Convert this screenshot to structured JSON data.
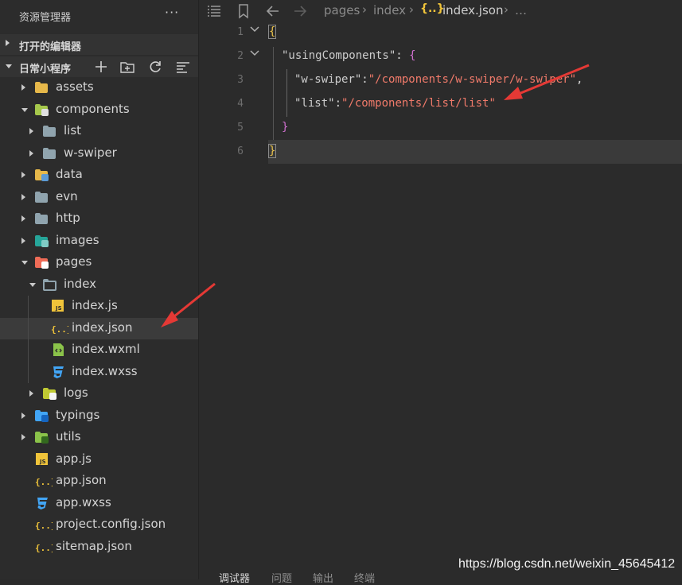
{
  "sidebar": {
    "title": "资源管理器",
    "more": "···",
    "open_editors": "打开的编辑器",
    "project_name": "日常小程序",
    "tree": [
      {
        "label": "assets",
        "depth": 1,
        "kind": "folder",
        "twisty": "right",
        "color": "#e6b84a",
        "icon": "folder-icon"
      },
      {
        "label": "components",
        "depth": 1,
        "kind": "folder",
        "twisty": "down",
        "color": "#a6c84c",
        "icon": "components-folder-icon"
      },
      {
        "label": "list",
        "depth": 2,
        "kind": "folder",
        "twisty": "right",
        "color": "#90a4ae",
        "icon": "folder-icon"
      },
      {
        "label": "w-swiper",
        "depth": 2,
        "kind": "folder",
        "twisty": "right",
        "color": "#90a4ae",
        "icon": "folder-icon"
      },
      {
        "label": "data",
        "depth": 1,
        "kind": "folder",
        "twisty": "right",
        "color": "#e6b84a",
        "icon": "data-folder-icon"
      },
      {
        "label": "evn",
        "depth": 1,
        "kind": "folder",
        "twisty": "right",
        "color": "#90a4ae",
        "icon": "folder-icon"
      },
      {
        "label": "http",
        "depth": 1,
        "kind": "folder",
        "twisty": "right",
        "color": "#90a4ae",
        "icon": "folder-icon"
      },
      {
        "label": "images",
        "depth": 1,
        "kind": "folder",
        "twisty": "right",
        "color": "#26a69a",
        "icon": "images-folder-icon"
      },
      {
        "label": "pages",
        "depth": 1,
        "kind": "folder",
        "twisty": "down",
        "color": "#ef6c57",
        "icon": "pages-folder-icon"
      },
      {
        "label": "index",
        "depth": 2,
        "kind": "folder",
        "twisty": "down",
        "color": "#90a4ae",
        "icon": "folder-open-icon"
      },
      {
        "label": "index.js",
        "depth": 3,
        "kind": "file",
        "ftype": "js"
      },
      {
        "label": "index.json",
        "depth": 3,
        "kind": "file",
        "ftype": "json",
        "selected": true
      },
      {
        "label": "index.wxml",
        "depth": 3,
        "kind": "file",
        "ftype": "wxml"
      },
      {
        "label": "index.wxss",
        "depth": 3,
        "kind": "file",
        "ftype": "wxss"
      },
      {
        "label": "logs",
        "depth": 2,
        "kind": "folder",
        "twisty": "right",
        "color": "#c0ca33",
        "icon": "logs-folder-icon"
      },
      {
        "label": "typings",
        "depth": 1,
        "kind": "folder",
        "twisty": "right",
        "color": "#42a5f5",
        "icon": "typings-folder-icon"
      },
      {
        "label": "utils",
        "depth": 1,
        "kind": "folder",
        "twisty": "right",
        "color": "#8bc34a",
        "icon": "utils-folder-icon"
      },
      {
        "label": "app.js",
        "depth": 1,
        "kind": "file",
        "ftype": "js"
      },
      {
        "label": "app.json",
        "depth": 1,
        "kind": "file",
        "ftype": "json"
      },
      {
        "label": "app.wxss",
        "depth": 1,
        "kind": "file",
        "ftype": "wxss"
      },
      {
        "label": "project.config.json",
        "depth": 1,
        "kind": "file",
        "ftype": "json"
      },
      {
        "label": "sitemap.json",
        "depth": 1,
        "kind": "file",
        "ftype": "json"
      }
    ]
  },
  "breadcrumb": {
    "items": [
      "pages",
      "index",
      "index.json"
    ],
    "json_glyph": "{..}",
    "trailing": "…"
  },
  "editor": {
    "line_numbers": [
      "1",
      "2",
      "3",
      "4",
      "5",
      "6"
    ],
    "line1": "{",
    "line2_key": "\"usingComponents\"",
    "line2_colon": ": ",
    "line2_brace": "{",
    "line3_key": "\"w-swiper\"",
    "line3_colon": ":",
    "line3_val": "\"/components/w-swiper/w-swiper\"",
    "line3_comma": ",",
    "line4_key": "\"list\"",
    "line4_colon": ":",
    "line4_val": "\"/components/list/list\"",
    "line5": "}",
    "line6": "}"
  },
  "panel": {
    "tabs": [
      "调试器",
      "问题",
      "输出",
      "终端"
    ]
  },
  "watermark": "https://blog.csdn.net/weixin_45645412",
  "colors": {
    "sidebar_bg": "#2c2c2c",
    "editor_bg": "#2b2b2b",
    "string": "#f07a6a",
    "arrow": "#e53935",
    "json_icon": "#f0c43a",
    "js_icon": "#f0c43a",
    "wxss_icon": "#42a5f5",
    "wxml_icon": "#8bc34a"
  }
}
